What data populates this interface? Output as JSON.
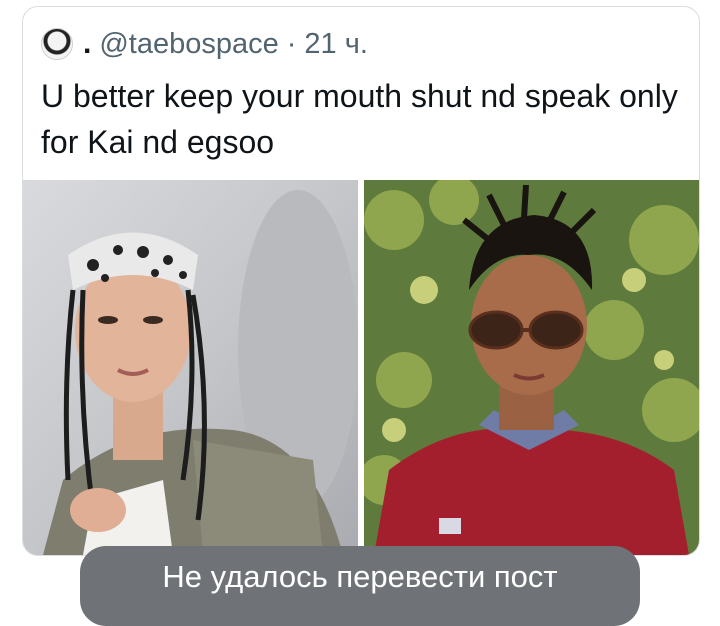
{
  "tweet": {
    "display_name": ".",
    "handle": "@taebospace",
    "separator": "·",
    "time": "21 ч.",
    "text": "U better keep your mouth shut nd speak only for Kai nd egsoo",
    "media": [
      {
        "icon": "photo-left-person-bandana"
      },
      {
        "icon": "photo-right-person-sunglasses"
      }
    ]
  },
  "toast": {
    "text": "Не удалось перевести пост"
  }
}
